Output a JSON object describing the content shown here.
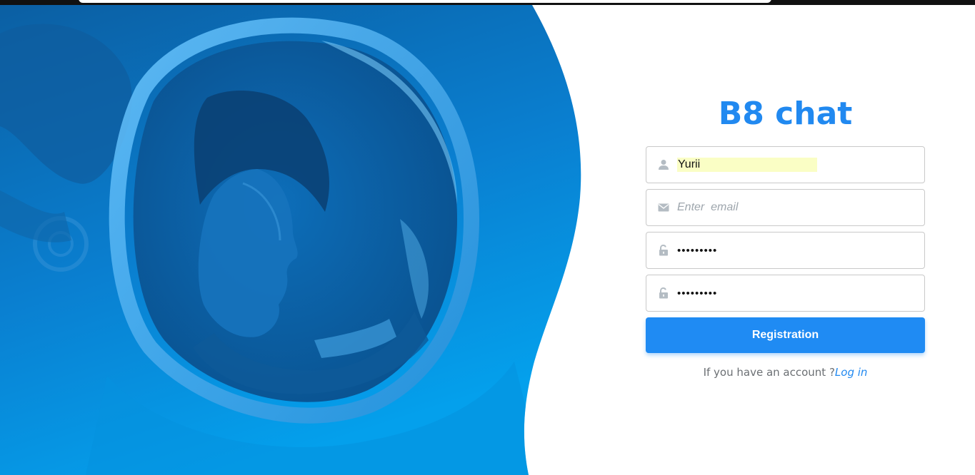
{
  "brand": {
    "title": "B8 chat",
    "color": "#2189f0"
  },
  "form": {
    "username": {
      "value": "Yurii",
      "icon": "user-icon"
    },
    "email": {
      "value": "",
      "placeholder": "Enter  email",
      "icon": "envelope-icon"
    },
    "password": {
      "value": "•••••••••",
      "icon": "unlock-icon"
    },
    "confirm_password": {
      "value": "•••••••••",
      "icon": "unlock-icon"
    },
    "submit_label": "Registration",
    "account_prompt": "If you have an account ?",
    "login_link": "Log in"
  },
  "colors": {
    "accent": "#1f8bf3",
    "hero_blue_dark": "#0a63a8",
    "hero_blue_light": "#039be5",
    "autofill_bg": "#fafec5"
  }
}
